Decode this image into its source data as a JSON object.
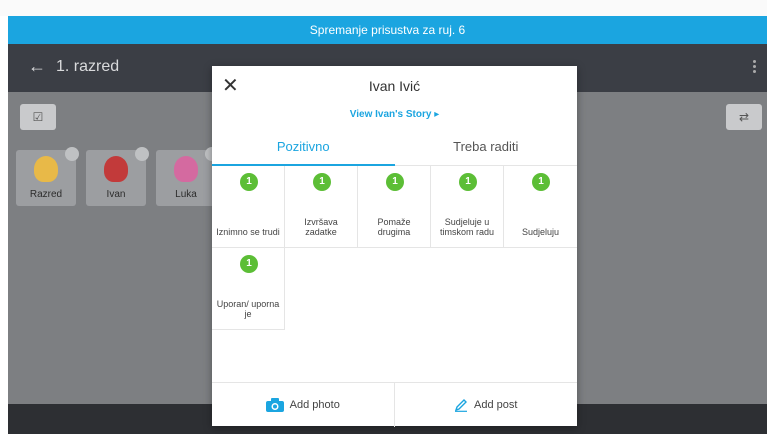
{
  "banner": {
    "text": "Spremanje prisustva za ruj. 6"
  },
  "appbar": {
    "back_icon": "arrow-left-icon",
    "title": "1. razred"
  },
  "background_cards": [
    {
      "label": "Razred",
      "color": "#e8b948"
    },
    {
      "label": "Ivan",
      "color": "#c23a3a"
    },
    {
      "label": "Luka",
      "color": "#d46aa0"
    }
  ],
  "modal": {
    "close_label": "✕",
    "title": "Ivan Ivić",
    "story_link": "View Ivan's Story ▸",
    "tabs": [
      {
        "label": "Pozitivno",
        "active": true
      },
      {
        "label": "Treba raditi",
        "active": false
      }
    ],
    "skills": [
      {
        "points": "1",
        "label": "Iznimno se trudi"
      },
      {
        "points": "1",
        "label": "Izvršava zadatke"
      },
      {
        "points": "1",
        "label": "Pomaže drugima"
      },
      {
        "points": "1",
        "label": "Sudjeluje u timskom radu"
      },
      {
        "points": "1",
        "label": "Sudjeluju"
      },
      {
        "points": "1",
        "label": "Uporan/ uporna je"
      }
    ],
    "footer": {
      "add_photo": "Add photo",
      "add_post": "Add post"
    }
  },
  "colors": {
    "accent": "#1ba5e0",
    "points": "#5cbe36",
    "appbar": "#3b3e45"
  }
}
